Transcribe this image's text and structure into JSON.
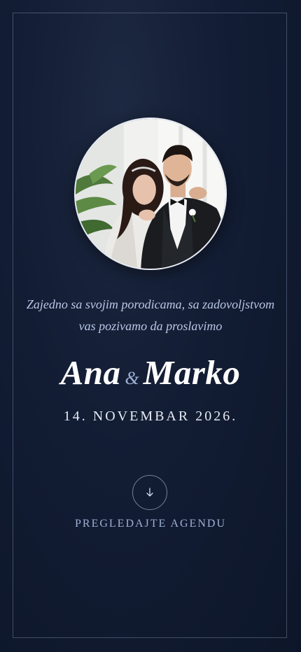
{
  "couple_photo": {
    "icon": "couple-photo"
  },
  "intro": {
    "line1": "Zajedno sa svojim porodicama, sa zadovoljstvom",
    "line2": "vas pozivamo da proslavimo"
  },
  "names": {
    "bride": "Ana",
    "ampersand": "&",
    "groom": "Marko"
  },
  "event": {
    "date": "14. NOVEMBAR 2026."
  },
  "cta": {
    "icon": "arrow-down-icon",
    "label": "PREGLEDAJTE AGENDU"
  },
  "colors": {
    "background": "#121c33",
    "accent": "#9fb0d6",
    "text": "#ffffff"
  }
}
